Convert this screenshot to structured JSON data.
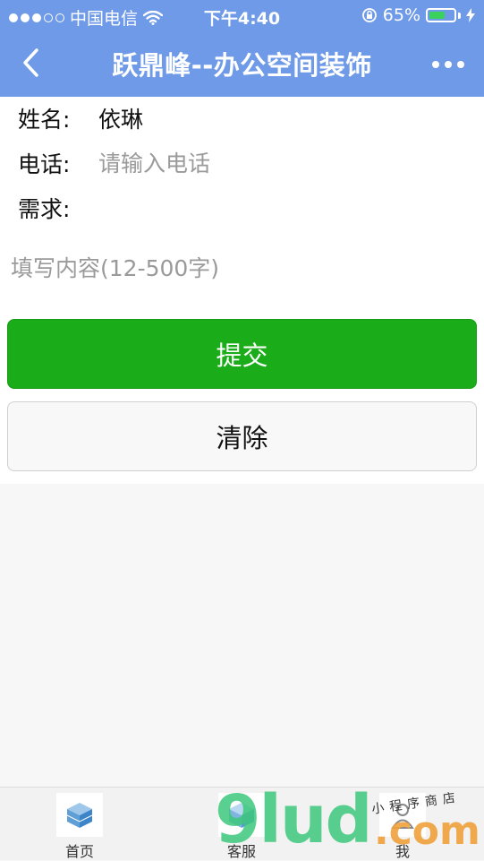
{
  "status_bar": {
    "carrier": "中国电信",
    "time": "下午4:40",
    "battery_percent": "65%",
    "battery_level": 0.65,
    "signal_filled": 3,
    "signal_total": 5
  },
  "nav": {
    "title": "跃鼎峰--办公空间装饰",
    "back_icon": "chevron-left-icon",
    "more_icon": "more-dots-icon"
  },
  "form": {
    "name_label": "姓名:",
    "name_value": "依琳",
    "phone_label": "电话:",
    "phone_placeholder": "请输入电话",
    "need_label": "需求:",
    "content_placeholder": "填写内容(12-500字)",
    "submit_label": "提交",
    "clear_label": "清除"
  },
  "tabbar": {
    "items": [
      {
        "label": "首页",
        "icon": "home-cube-icon"
      },
      {
        "label": "客服",
        "icon": "service-cube-icon"
      },
      {
        "label": "我",
        "icon": "person-icon"
      }
    ]
  },
  "watermark": {
    "brand": "9lud",
    "suffix": ".com",
    "tagline": "小程序商店"
  },
  "colors": {
    "nav_bg": "#6e9ae8",
    "submit_bg": "#1aad19",
    "battery_green": "#3ad15c"
  }
}
